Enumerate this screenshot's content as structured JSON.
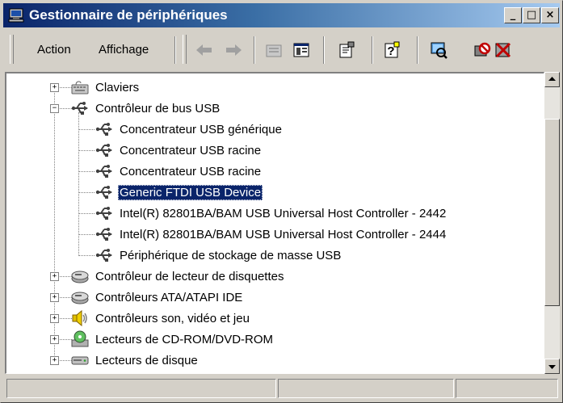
{
  "window": {
    "title": "Gestionnaire de périphériques"
  },
  "title_buttons": {
    "minimize": "_",
    "maximize": "□",
    "close": "×"
  },
  "menu": {
    "action": "Action",
    "view": "Affichage"
  },
  "toolbar": {
    "icons": [
      "back-arrow-icon",
      "forward-arrow-icon",
      "up-folder-icon",
      "show-hide-tree-icon",
      "properties-icon",
      "help-icon",
      "scan-hardware-icon",
      "disable-device-icon",
      "uninstall-device-icon"
    ]
  },
  "tree": {
    "items": [
      {
        "label": "Claviers",
        "icon": "keyboard-icon",
        "expander": "+"
      },
      {
        "label": "Contrôleur de bus USB",
        "icon": "usb-icon",
        "expander": "−"
      },
      {
        "label": "Concentrateur USB générique",
        "icon": "usb-icon"
      },
      {
        "label": "Concentrateur USB racine",
        "icon": "usb-icon"
      },
      {
        "label": "Concentrateur USB racine",
        "icon": "usb-icon"
      },
      {
        "label": "Generic FTDI USB Device",
        "icon": "usb-icon",
        "selected": true
      },
      {
        "label": "Intel(R) 82801BA/BAM USB Universal Host Controller - 2442",
        "icon": "usb-icon"
      },
      {
        "label": "Intel(R) 82801BA/BAM USB Universal Host Controller - 2444",
        "icon": "usb-icon"
      },
      {
        "label": "Périphérique de stockage de masse USB",
        "icon": "usb-icon"
      },
      {
        "label": "Contrôleur de lecteur de disquettes",
        "icon": "floppy-controller-icon",
        "expander": "+"
      },
      {
        "label": "Contrôleurs ATA/ATAPI IDE",
        "icon": "ide-controller-icon",
        "expander": "+"
      },
      {
        "label": "Contrôleurs son, vidéo et jeu",
        "icon": "speaker-icon",
        "expander": "+"
      },
      {
        "label": "Lecteurs de CD-ROM/DVD-ROM",
        "icon": "cdrom-icon",
        "expander": "+"
      },
      {
        "label": "Lecteurs de disque",
        "icon": "disk-drive-icon",
        "expander": "+"
      }
    ]
  },
  "colors": {
    "title_start": "#0a246a",
    "title_end": "#a6caf0",
    "selection": "#0a246a",
    "chrome": "#d4d0c8"
  }
}
